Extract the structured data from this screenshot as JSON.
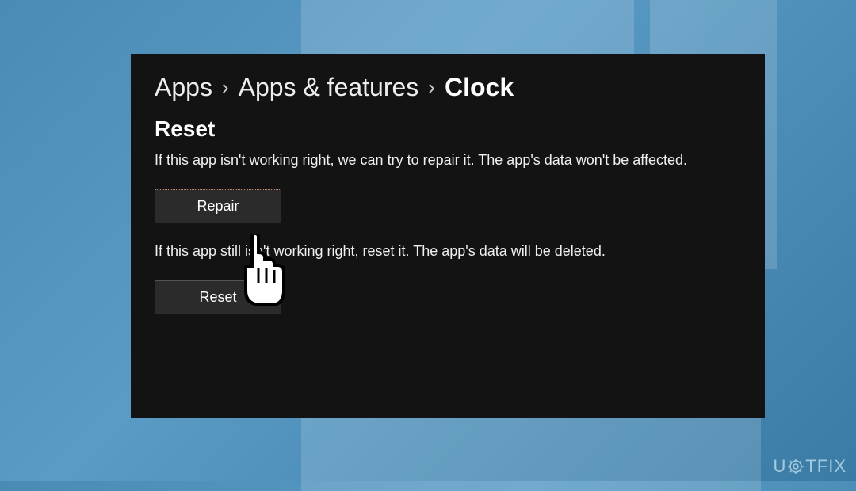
{
  "breadcrumb": {
    "items": [
      {
        "label": "Apps",
        "current": false
      },
      {
        "label": "Apps & features",
        "current": false
      },
      {
        "label": "Clock",
        "current": true
      }
    ],
    "separator": "›"
  },
  "section": {
    "title": "Reset",
    "repair_description": "If this app isn't working right, we can try to repair it. The app's data won't be affected.",
    "repair_button": "Repair",
    "reset_description": "If this app still isn't working right, reset it. The app's data will be deleted.",
    "reset_button": "Reset"
  },
  "watermark": {
    "prefix": "U",
    "middle": "G",
    "suffix": "TFIX"
  }
}
